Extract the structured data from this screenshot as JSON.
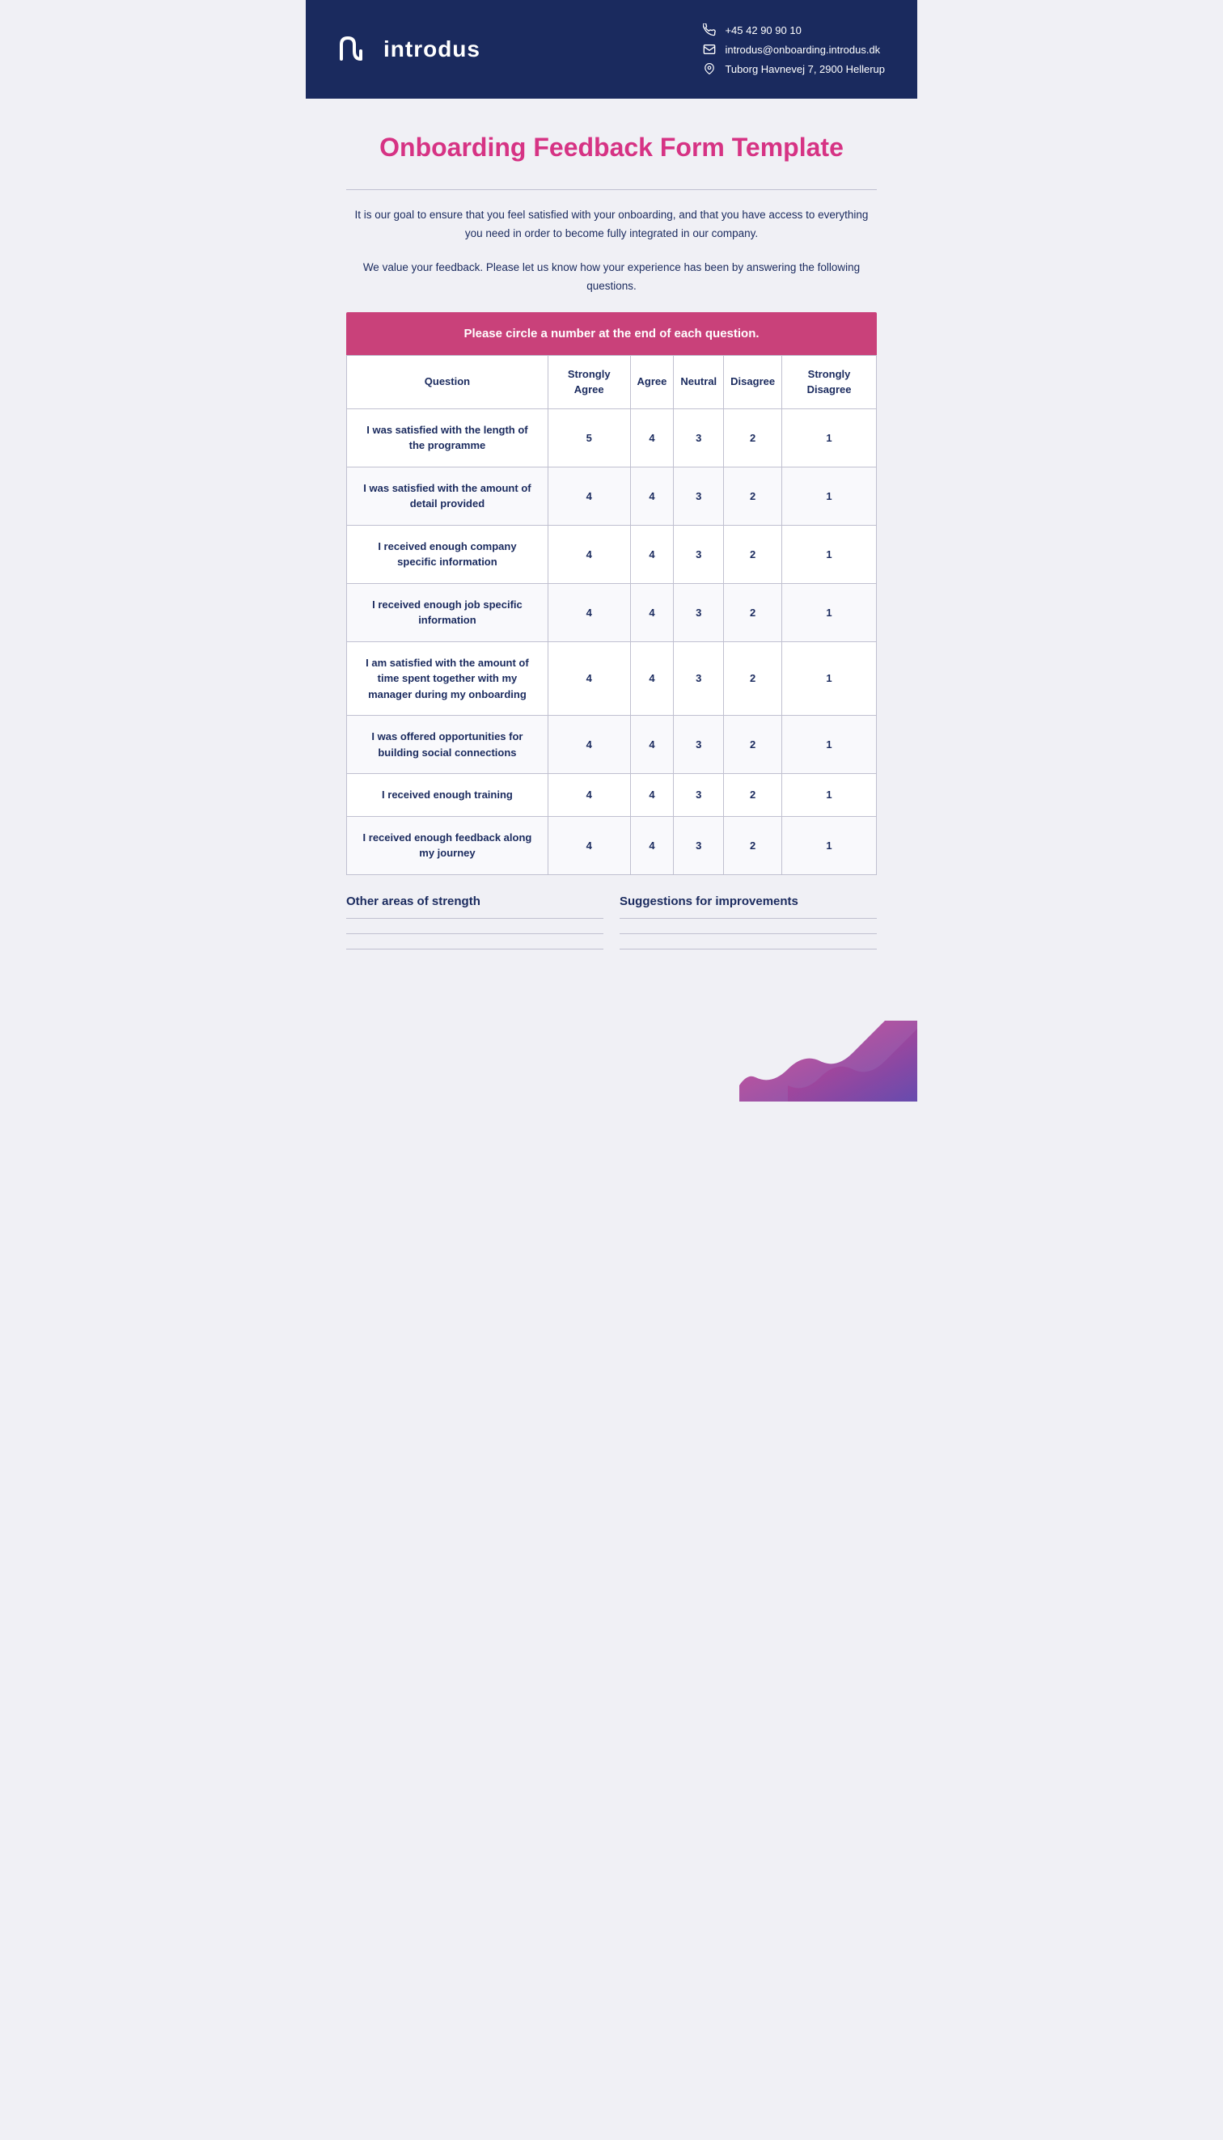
{
  "header": {
    "logo_symbol": "∩u",
    "logo_name": "introdus",
    "phone": "+45 42 90 90 10",
    "email": "introdus@onboarding.introdus.dk",
    "address": "Tuborg Havnevej 7, 2900 Hellerup"
  },
  "page_title": "Onboarding Feedback Form Template",
  "intro_paragraph1": "It is our goal to ensure that you feel satisfied with your onboarding, and that you have access to everything you need in order to become fully integrated in our company.",
  "intro_paragraph2": "We value your feedback. Please let us know how your experience has been by answering the following questions.",
  "instruction_banner": "Please circle a number at the end of each question.",
  "table": {
    "headers": {
      "question": "Question",
      "strongly_agree": "Strongly Agree",
      "agree": "Agree",
      "neutral": "Neutral",
      "disagree": "Disagree",
      "strongly_disagree": "Strongly Disagree"
    },
    "rows": [
      {
        "question": "I was satisfied with the length of the programme",
        "strongly_agree": "5",
        "agree": "4",
        "neutral": "3",
        "disagree": "2",
        "strongly_disagree": "1"
      },
      {
        "question": "I was satisfied with the amount of detail provided",
        "strongly_agree": "4",
        "agree": "4",
        "neutral": "3",
        "disagree": "2",
        "strongly_disagree": "1"
      },
      {
        "question": "I received enough company specific information",
        "strongly_agree": "4",
        "agree": "4",
        "neutral": "3",
        "disagree": "2",
        "strongly_disagree": "1"
      },
      {
        "question": "I received enough job specific information",
        "strongly_agree": "4",
        "agree": "4",
        "neutral": "3",
        "disagree": "2",
        "strongly_disagree": "1"
      },
      {
        "question": "I am satisfied with the amount of time spent together with my manager during my onboarding",
        "strongly_agree": "4",
        "agree": "4",
        "neutral": "3",
        "disagree": "2",
        "strongly_disagree": "1"
      },
      {
        "question": "I was offered opportunities for building social connections",
        "strongly_agree": "4",
        "agree": "4",
        "neutral": "3",
        "disagree": "2",
        "strongly_disagree": "1"
      },
      {
        "question": "I received enough training",
        "strongly_agree": "4",
        "agree": "4",
        "neutral": "3",
        "disagree": "2",
        "strongly_disagree": "1"
      },
      {
        "question": "I received enough feedback along my journey",
        "strongly_agree": "4",
        "agree": "4",
        "neutral": "3",
        "disagree": "2",
        "strongly_disagree": "1"
      }
    ]
  },
  "bottom": {
    "strengths_label": "Other areas of strength",
    "suggestions_label": "Suggestions for improvements"
  },
  "colors": {
    "brand_navy": "#1a2a5e",
    "brand_pink": "#d63384",
    "banner_pink": "#c9417a",
    "wave_gradient_start": "#d63384",
    "wave_gradient_end": "#5b3ea8"
  }
}
